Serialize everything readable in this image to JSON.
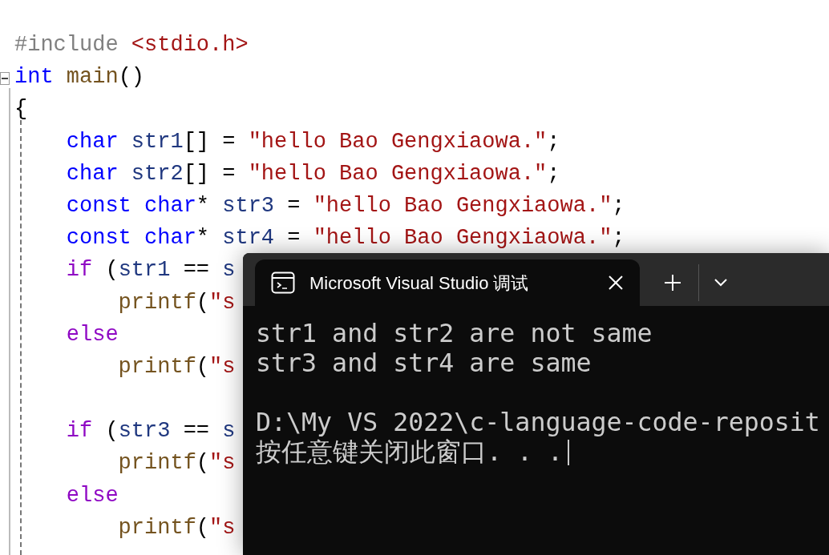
{
  "editor": {
    "folding": {
      "expanded": true
    },
    "lines": [
      {
        "kind": "code",
        "tokens": [
          {
            "text": "#include ",
            "kind": "directive"
          },
          {
            "text": "<stdio.h>",
            "kind": "string"
          }
        ]
      },
      {
        "kind": "code",
        "tokens": [
          {
            "text": "int ",
            "kind": "keyword"
          },
          {
            "text": "main",
            "kind": "function"
          },
          {
            "text": "()",
            "kind": "plain"
          }
        ]
      },
      {
        "kind": "code",
        "tokens": [
          {
            "text": "{",
            "kind": "plain"
          }
        ]
      },
      {
        "kind": "code",
        "tokens": [
          {
            "text": "    char ",
            "kind": "keyword"
          },
          {
            "text": "str1",
            "kind": "identifier"
          },
          {
            "text": "[] = ",
            "kind": "plain"
          },
          {
            "text": "\"hello Bao Gengxiaowa.\"",
            "kind": "string"
          },
          {
            "text": ";",
            "kind": "plain"
          }
        ]
      },
      {
        "kind": "code",
        "tokens": [
          {
            "text": "    char ",
            "kind": "keyword"
          },
          {
            "text": "str2",
            "kind": "identifier"
          },
          {
            "text": "[] = ",
            "kind": "plain"
          },
          {
            "text": "\"hello Bao Gengxiaowa.\"",
            "kind": "string"
          },
          {
            "text": ";",
            "kind": "plain"
          }
        ]
      },
      {
        "kind": "code",
        "tokens": [
          {
            "text": "    const char",
            "kind": "keyword"
          },
          {
            "text": "* ",
            "kind": "plain"
          },
          {
            "text": "str3",
            "kind": "identifier"
          },
          {
            "text": " = ",
            "kind": "plain"
          },
          {
            "text": "\"hello Bao Gengxiaowa.\"",
            "kind": "string"
          },
          {
            "text": ";",
            "kind": "plain"
          }
        ]
      },
      {
        "kind": "code",
        "tokens": [
          {
            "text": "    const char",
            "kind": "keyword"
          },
          {
            "text": "* ",
            "kind": "plain"
          },
          {
            "text": "str4",
            "kind": "identifier"
          },
          {
            "text": " = ",
            "kind": "plain"
          },
          {
            "text": "\"hello Bao Gengxiaowa.\"",
            "kind": "string"
          },
          {
            "text": ";",
            "kind": "plain"
          }
        ]
      },
      {
        "kind": "code",
        "tokens": [
          {
            "text": "    if",
            "kind": "control"
          },
          {
            "text": " (",
            "kind": "plain"
          },
          {
            "text": "str1",
            "kind": "identifier"
          },
          {
            "text": " == ",
            "kind": "plain"
          },
          {
            "text": "s",
            "kind": "identifier"
          }
        ]
      },
      {
        "kind": "code",
        "tokens": [
          {
            "text": "        printf",
            "kind": "function"
          },
          {
            "text": "(",
            "kind": "plain"
          },
          {
            "text": "\"s",
            "kind": "string"
          }
        ]
      },
      {
        "kind": "code",
        "tokens": [
          {
            "text": "    else",
            "kind": "control"
          }
        ]
      },
      {
        "kind": "code",
        "tokens": [
          {
            "text": "        printf",
            "kind": "function"
          },
          {
            "text": "(",
            "kind": "plain"
          },
          {
            "text": "\"s",
            "kind": "string"
          }
        ]
      },
      {
        "kind": "blank"
      },
      {
        "kind": "code",
        "tokens": [
          {
            "text": "    if",
            "kind": "control"
          },
          {
            "text": " (",
            "kind": "plain"
          },
          {
            "text": "str3",
            "kind": "identifier"
          },
          {
            "text": " == ",
            "kind": "plain"
          },
          {
            "text": "s",
            "kind": "identifier"
          }
        ]
      },
      {
        "kind": "code",
        "tokens": [
          {
            "text": "        printf",
            "kind": "function"
          },
          {
            "text": "(",
            "kind": "plain"
          },
          {
            "text": "\"s",
            "kind": "string"
          }
        ]
      },
      {
        "kind": "code",
        "tokens": [
          {
            "text": "    else",
            "kind": "control"
          }
        ]
      },
      {
        "kind": "code",
        "tokens": [
          {
            "text": "        printf",
            "kind": "function"
          },
          {
            "text": "(",
            "kind": "plain"
          },
          {
            "text": "\"s",
            "kind": "string"
          }
        ]
      }
    ]
  },
  "terminal": {
    "tab": {
      "title": "Microsoft Visual Studio 调试",
      "selected": true
    },
    "output": [
      {
        "kind": "text",
        "text": "str1 and str2 are not same"
      },
      {
        "kind": "text",
        "text": "str3 and str4 are same"
      },
      {
        "kind": "blank"
      },
      {
        "kind": "text",
        "text": "D:\\My VS 2022\\c-language-code-reposit"
      },
      {
        "kind": "text",
        "text": "按任意键关闭此窗口. . ."
      }
    ],
    "cursor": true
  }
}
